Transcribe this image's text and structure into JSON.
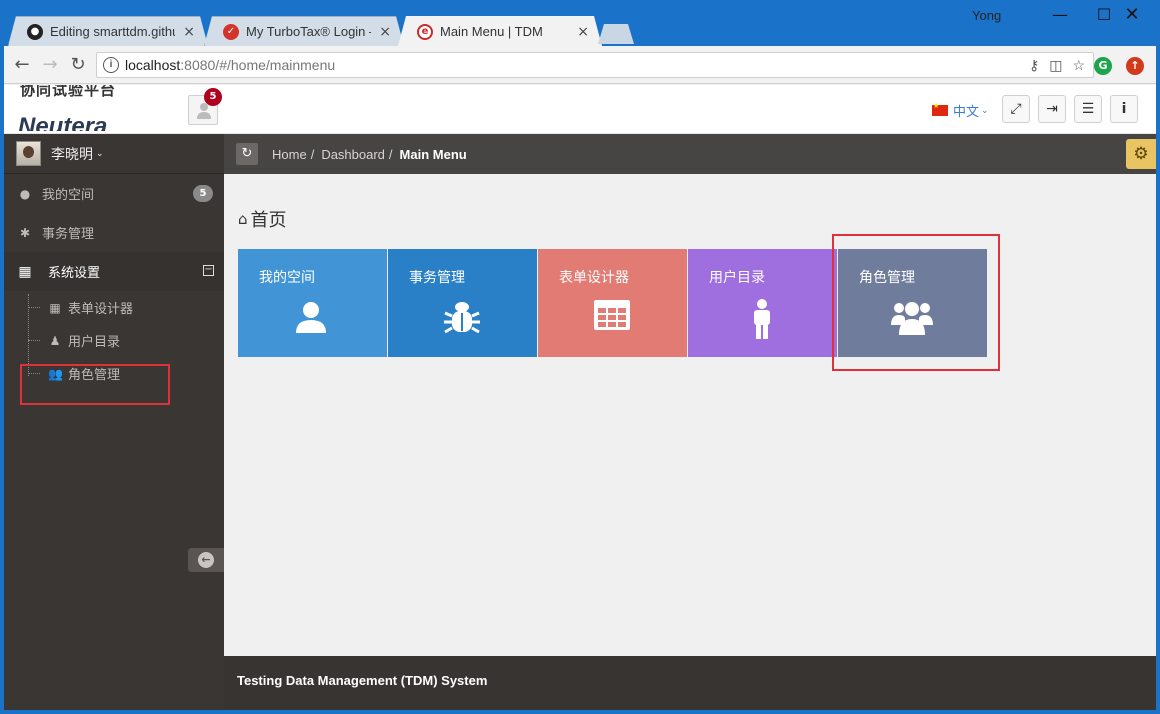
{
  "browser": {
    "tabs": [
      {
        "title": "Editing smarttdm.githu",
        "close": "×",
        "icon_color": "#222222"
      },
      {
        "title": "My TurboTax® Login –",
        "close": "×",
        "icon_color": "#d4352a"
      },
      {
        "title": "Main Menu | TDM",
        "close": "×",
        "icon_color": "#c92a2a"
      }
    ],
    "window_user": "Yong",
    "url_host": "localhost",
    "url_path": ":8080/#/home/mainmenu"
  },
  "header": {
    "notification_count": "5",
    "language": "中文",
    "logo_line1": "协同试验平台",
    "logo_line2": "Neutera"
  },
  "sidebar": {
    "user_name": "李晓明",
    "items": [
      {
        "label": "我的空间",
        "icon": "user-icon",
        "count": "5"
      },
      {
        "label": "事务管理",
        "icon": "bug-icon"
      },
      {
        "label": "系统设置",
        "icon": "building-icon",
        "toggle": "−"
      }
    ],
    "subitems": [
      {
        "label": "表单设计器",
        "icon": "table-icon"
      },
      {
        "label": "用户目录",
        "icon": "male-icon"
      },
      {
        "label": "角色管理",
        "icon": "users-icon"
      }
    ]
  },
  "breadcrumb": [
    {
      "label": "Home",
      "sep": "/"
    },
    {
      "label": "Dashboard",
      "sep": "/"
    },
    {
      "label": "Main Menu"
    }
  ],
  "page": {
    "title": "首页",
    "tiles": [
      {
        "label": "我的空间",
        "icon": "user-icon",
        "color": "#4195d6"
      },
      {
        "label": "事务管理",
        "icon": "bug-icon",
        "color": "#2a80c6"
      },
      {
        "label": "表单设计器",
        "icon": "table-icon",
        "color": "#e27b73"
      },
      {
        "label": "用户目录",
        "icon": "male-icon",
        "color": "#9f6fe0"
      },
      {
        "label": "角色管理",
        "icon": "users-icon",
        "color": "#6f7c9c"
      }
    ]
  },
  "footer": {
    "text": "Testing Data Management (TDM) System"
  },
  "colors": {
    "highlight": "#e0303a",
    "sidebar_bg": "#3a3633",
    "settings_button": "#e8c462"
  }
}
